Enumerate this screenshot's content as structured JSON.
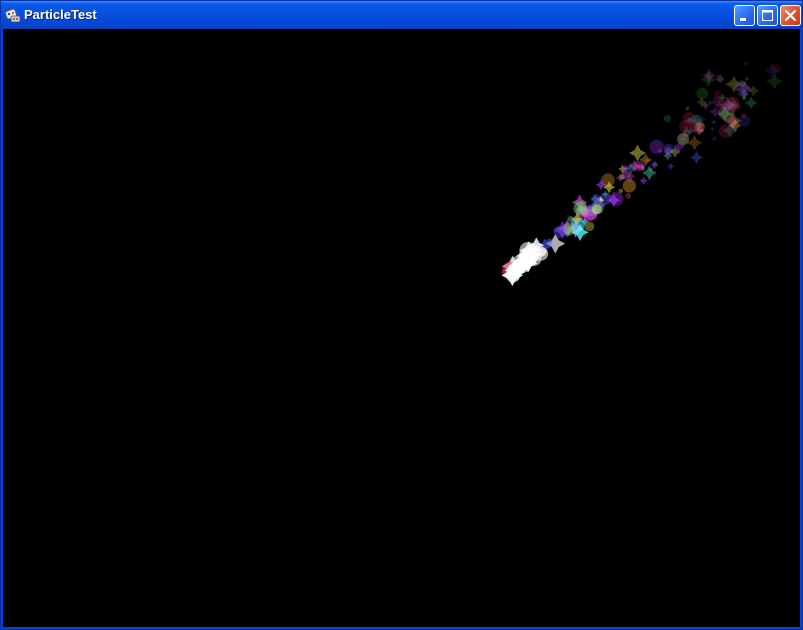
{
  "window": {
    "title": "ParticleTest",
    "icon": "game-controller-icon"
  },
  "caption_buttons": {
    "minimize_icon": "minimize-icon",
    "maximize_icon": "maximize-icon",
    "close_icon": "close-icon"
  },
  "canvas": {
    "background": "#000000",
    "content": "particle-emitter-trail",
    "palette": [
      "#ffffff",
      "#ff55ff",
      "#55ffff",
      "#ffaa33",
      "#55ff55",
      "#ff3355",
      "#5555ff",
      "#ffff55",
      "#33aaaa",
      "#aa33ff"
    ]
  }
}
